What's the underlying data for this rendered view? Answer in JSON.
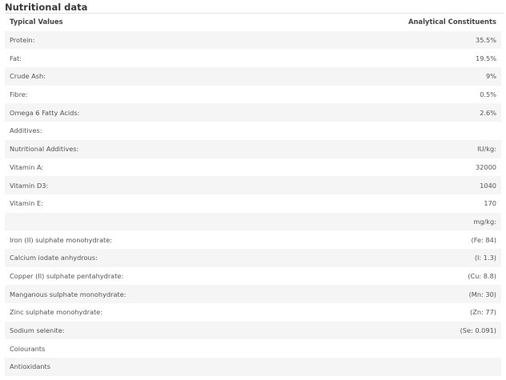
{
  "title": "Nutritional data",
  "headers": {
    "left": "Typical Values",
    "right": "Analytical Constituents"
  },
  "rows": [
    {
      "label": "Protein:",
      "value": "35.5%"
    },
    {
      "label": "Fat:",
      "value": "19.5%"
    },
    {
      "label": "Crude Ash:",
      "value": "9%"
    },
    {
      "label": "Fibre:",
      "value": "0.5%"
    },
    {
      "label": "Omega 6 Fatty Acids:",
      "value": "2.6%"
    },
    {
      "label": "Additives:",
      "value": ""
    },
    {
      "label": "Nutritional Additives:",
      "value": "IU/kg:"
    },
    {
      "label": "Vitamin A:",
      "value": "32000"
    },
    {
      "label": "Vitamin D3:",
      "value": "1040"
    },
    {
      "label": "Vitamin E:",
      "value": "170"
    },
    {
      "label": "",
      "value": "mg/kg:"
    },
    {
      "label": "Iron (II) sulphate monohydrate:",
      "value": "(Fe: 84)"
    },
    {
      "label": "Calcium iodate anhydrous:",
      "value": "(I: 1.3)"
    },
    {
      "label": "Copper (II) sulphate pentahydrate:",
      "value": "(Cu: 8.8)"
    },
    {
      "label": "Manganous sulphate monohydrate:",
      "value": "(Mn: 30)"
    },
    {
      "label": "Zinc sulphate monohydrate:",
      "value": "(Zn: 77)"
    },
    {
      "label": "Sodium selenite:",
      "value": "(Se: 0.091)"
    },
    {
      "label": "Colourants",
      "value": ""
    },
    {
      "label": "Antioxidants",
      "value": ""
    }
  ]
}
